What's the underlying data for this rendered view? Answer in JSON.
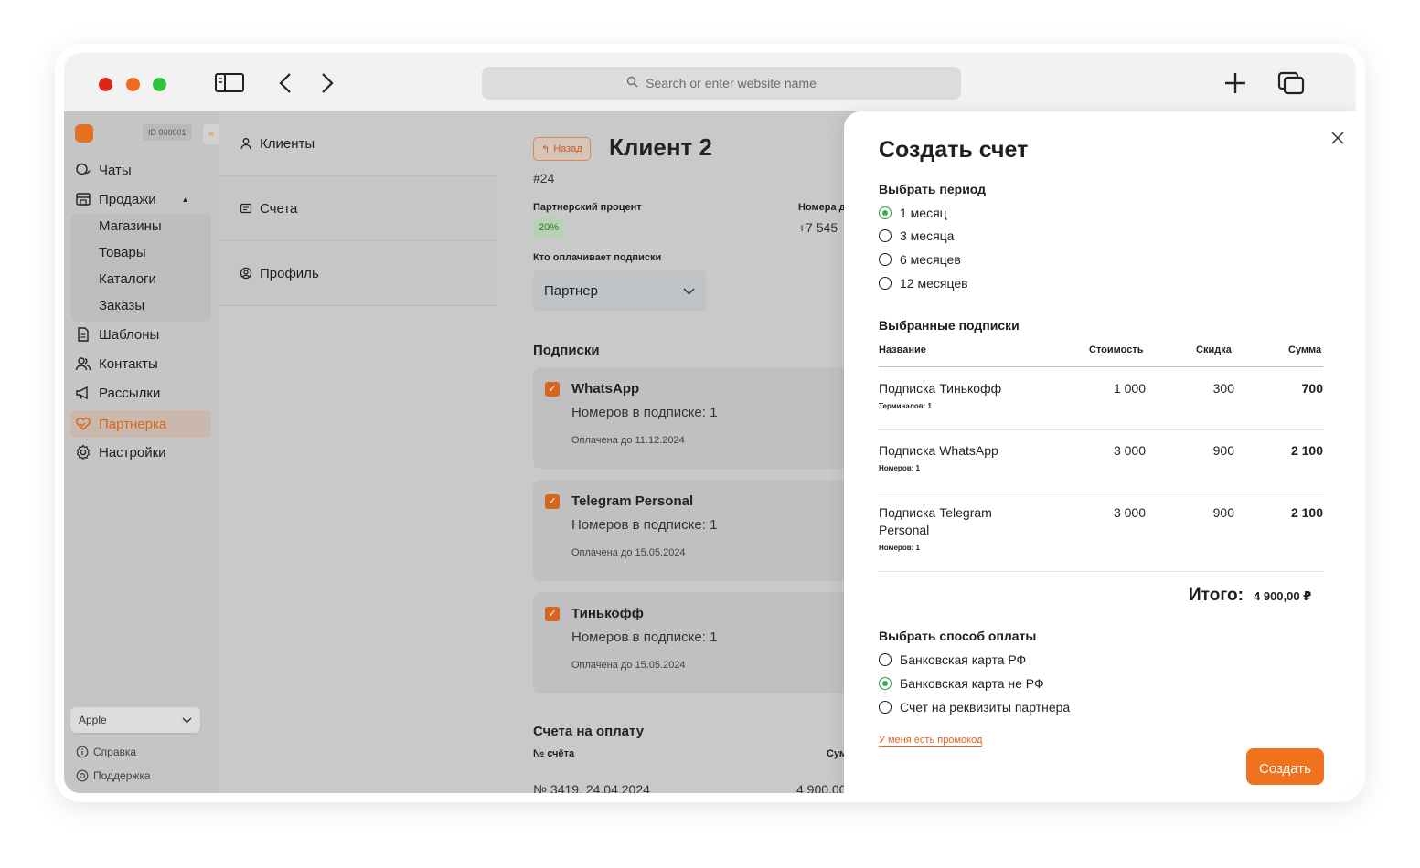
{
  "browser": {
    "url_placeholder": "Search or enter website name"
  },
  "sidebar": {
    "account_id": "ID 000001",
    "items": [
      {
        "label": "Чаты",
        "icon": "chat-icon"
      },
      {
        "label": "Продажи",
        "icon": "store-icon"
      },
      {
        "label": "Шаблоны",
        "icon": "document-icon"
      },
      {
        "label": "Контакты",
        "icon": "contacts-icon"
      },
      {
        "label": "Рассылки",
        "icon": "megaphone-icon"
      },
      {
        "label": "Партнерка",
        "icon": "handshake-icon"
      },
      {
        "label": "Настройки",
        "icon": "gear-icon"
      }
    ],
    "sales_subitems": [
      "Магазины",
      "Товары",
      "Каталоги",
      "Заказы"
    ],
    "store_select": "Apple",
    "help_label": "Справка",
    "support_label": "Поддержка"
  },
  "secondary_nav": {
    "items": [
      "Клиенты",
      "Счета",
      "Профиль"
    ]
  },
  "client": {
    "back_label": "Назад",
    "title": "Клиент 2",
    "id": "#24",
    "partner_percent_label": "Партнерский процент",
    "partner_percent": "20%",
    "phone_label": "Номера д",
    "phone": "+7 545",
    "payer_label": "Кто оплачивает подписки",
    "payer_value": "Партнер",
    "subscriptions_heading": "Подписки",
    "subscriptions": [
      {
        "name": "WhatsApp",
        "numbers": "Номеров в подписке: 1",
        "paid": "Оплачена до 11.12.2024"
      },
      {
        "name": "Telegram Personal",
        "numbers": "Номеров в подписке: 1",
        "paid": "Оплачена до 15.05.2024"
      },
      {
        "name": "Тинькофф",
        "numbers": "Номеров в подписке: 1",
        "paid": "Оплачена до 15.05.2024"
      }
    ],
    "invoices_heading": "Счета на оплату",
    "invoices_col_number": "№ счёта",
    "invoices_col_sum": "Сум",
    "invoice_row_number": "№ 3419, 24.04.2024",
    "invoice_row_sum": "4 900,00"
  },
  "modal": {
    "title": "Создать счет",
    "period_heading": "Выбрать период",
    "periods": [
      {
        "label": "1 месяц",
        "selected": true
      },
      {
        "label": "3 месяца",
        "selected": false
      },
      {
        "label": "6 месяцев",
        "selected": false
      },
      {
        "label": "12 месяцев",
        "selected": false
      }
    ],
    "selected_heading": "Выбранные подписки",
    "columns": {
      "name": "Название",
      "cost": "Стоимость",
      "discount": "Скидка",
      "sum": "Сумма"
    },
    "rows": [
      {
        "name": "Подписка Тинькофф",
        "sub": "Терминалов: 1",
        "cost": "1 000",
        "discount": "300",
        "sum": "700"
      },
      {
        "name": "Подписка WhatsApp",
        "sub": "Номеров: 1",
        "cost": "3 000",
        "discount": "900",
        "sum": "2 100"
      },
      {
        "name_line1": "Подписка Telegram",
        "name_line2": "Personal",
        "sub": "Номеров: 1",
        "cost": "3 000",
        "discount": "900",
        "sum": "2 100"
      }
    ],
    "total_label": "Итого:",
    "total_value": "4 900,00 ₽",
    "payment_heading": "Выбрать способ оплаты",
    "payments": [
      {
        "label": "Банковская карта РФ",
        "selected": false
      },
      {
        "label": "Банковская карта не РФ",
        "selected": true
      },
      {
        "label": "Счет на реквизиты партнера",
        "selected": false
      }
    ],
    "promo_label": "У меня есть промокод",
    "create_label": "Создать"
  },
  "colors": {
    "accent": "#f0711e",
    "selected_radio": "#2fb34f"
  }
}
